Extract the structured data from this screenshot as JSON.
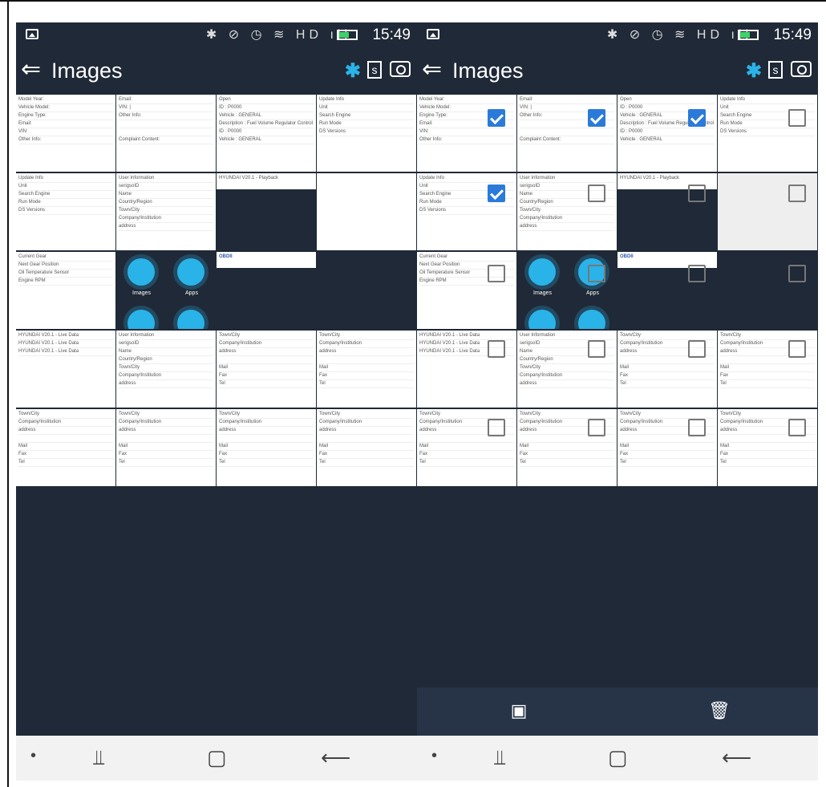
{
  "status": {
    "time": "15:49",
    "icons_text": "✱ ⊘ ◷ ≋ HD ıll"
  },
  "appbar": {
    "title": "Images",
    "back_glyph": "⇐",
    "bluetooth_glyph": "✱",
    "sbox_glyph": "s"
  },
  "menu": {
    "images_label": "Images",
    "apps_label": "Apps"
  },
  "thumbs": {
    "a1": [
      "Model Year:",
      "Vehicle Model:",
      "Engine Type:",
      "Email:",
      "VIN:",
      "Other Info:"
    ],
    "a2": [
      "Email:",
      "VIN: |",
      "Other Info:",
      "",
      "",
      "Complaint Content:"
    ],
    "a3": [
      "Open",
      "ID : P0000",
      "Vehicle : GENERAL",
      "Description : Fuel Volume Regulator Control Circuit Range/Performance",
      "ID : P0000",
      "Vehicle : GENERAL"
    ],
    "a4": [
      "Update Info",
      "Unit",
      "Search Engine",
      "Run Mode",
      "DS Versions"
    ],
    "b1": [
      "Update Info",
      "Unit",
      "Search Engine",
      "Run Mode",
      "DS Versions"
    ],
    "b2": [
      "User Information",
      "serigsoID",
      "Name",
      "Country/Region",
      "Town/City",
      "Company/Institution",
      "address"
    ],
    "b3": "HYUNDAI V20.1 - Playback",
    "c1": [
      "Current Gear",
      "Next Gear Position",
      "Oil Temperature Sensor",
      "Engine RPM"
    ],
    "c3": "OBDII",
    "d1": [
      "HYUNDAI V20.1 - Live Data",
      "HYUNDAI V20.1 - Live Data",
      "HYUNDAI V20.1 - Live Data"
    ],
    "d2": [
      "User Information",
      "serigsoID",
      "Name",
      "Country/Region",
      "Town/City",
      "Company/Institution",
      "address"
    ],
    "d3": [
      "Town/City",
      "Company/Institution",
      "address",
      "",
      "Mail",
      "Fax",
      "Tel"
    ],
    "d4": [
      "Town/City",
      "Company/Institution",
      "address",
      "",
      "Mail",
      "Fax",
      "Tel"
    ],
    "e": [
      "Town/City",
      "Company/Institution",
      "address",
      "",
      "Mail",
      "Fax",
      "Tel"
    ]
  },
  "actions": {
    "select_all_glyph": "▣",
    "delete_glyph": "🗑"
  },
  "nav": {
    "dot": "•",
    "recent": "⫫",
    "home": "▢",
    "back": "⟵"
  }
}
